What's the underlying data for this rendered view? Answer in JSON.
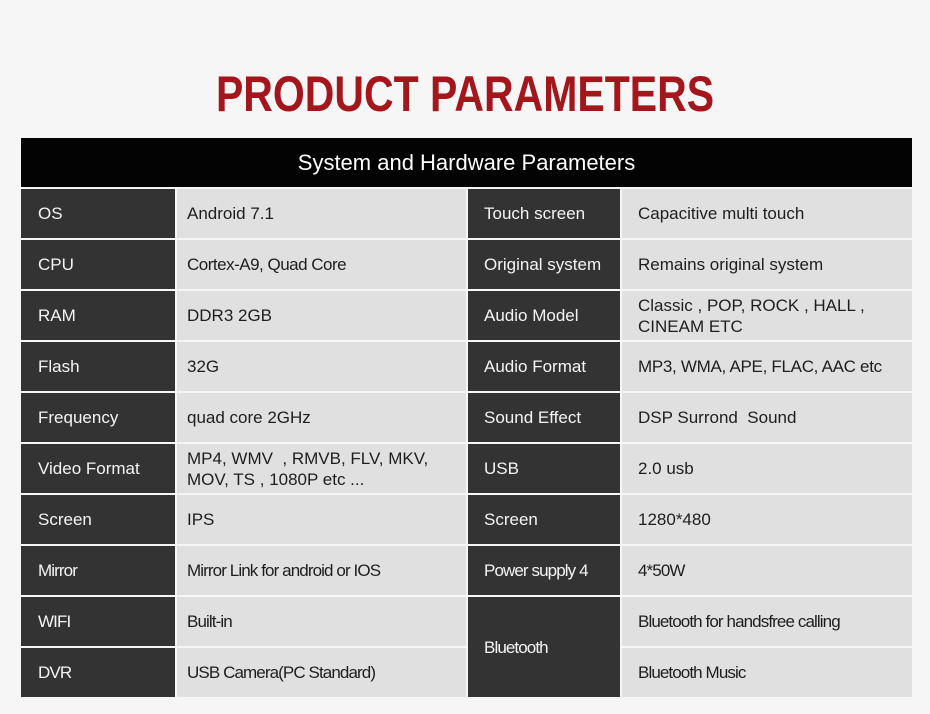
{
  "page": {
    "title": "PRODUCT PARAMETERS"
  },
  "table": {
    "header": "System and Hardware Parameters",
    "left": [
      {
        "label": "OS",
        "value": "Android 7.1"
      },
      {
        "label": "CPU",
        "value": "Cortex-A9, Quad Core"
      },
      {
        "label": "RAM",
        "value": "DDR3 2GB"
      },
      {
        "label": "Flash",
        "value": "32G"
      },
      {
        "label": "Frequency",
        "value": "quad core 2GHz"
      },
      {
        "label": "Video Format",
        "value": "MP4, WMV  , RMVB, FLV, MKV, MOV, TS , 1080P etc ..."
      },
      {
        "label": "Screen",
        "value": "IPS"
      },
      {
        "label": "Mirror",
        "value": "Mirror Link for android or IOS"
      },
      {
        "label": "WIFI",
        "value": "Built-in"
      },
      {
        "label": "DVR",
        "value": "USB Camera(PC Standard)"
      }
    ],
    "right": [
      {
        "label": "Touch screen",
        "value": "Capacitive multi touch"
      },
      {
        "label": "Original system",
        "value": "Remains original system"
      },
      {
        "label": "Audio Model",
        "value": "Classic , POP, ROCK , HALL , CINEAM ETC"
      },
      {
        "label": "Audio Format",
        "value": "MP3, WMA, APE, FLAC, AAC etc"
      },
      {
        "label": "Sound Effect",
        "value": "DSP Surrond  Sound"
      },
      {
        "label": "USB",
        "value": "2.0 usb"
      },
      {
        "label": "Screen",
        "value": "1280*480"
      },
      {
        "label": "Power supply 4",
        "value": "4*50W"
      },
      {
        "label": "Bluetooth",
        "values": [
          "Bluetooth for handsfree calling",
          "Bluetooth Music"
        ]
      }
    ]
  },
  "colors": {
    "title": "#a3161c",
    "header_bg": "#030303",
    "label_bg": "#333333",
    "value_bg": "#e0e0e0"
  }
}
